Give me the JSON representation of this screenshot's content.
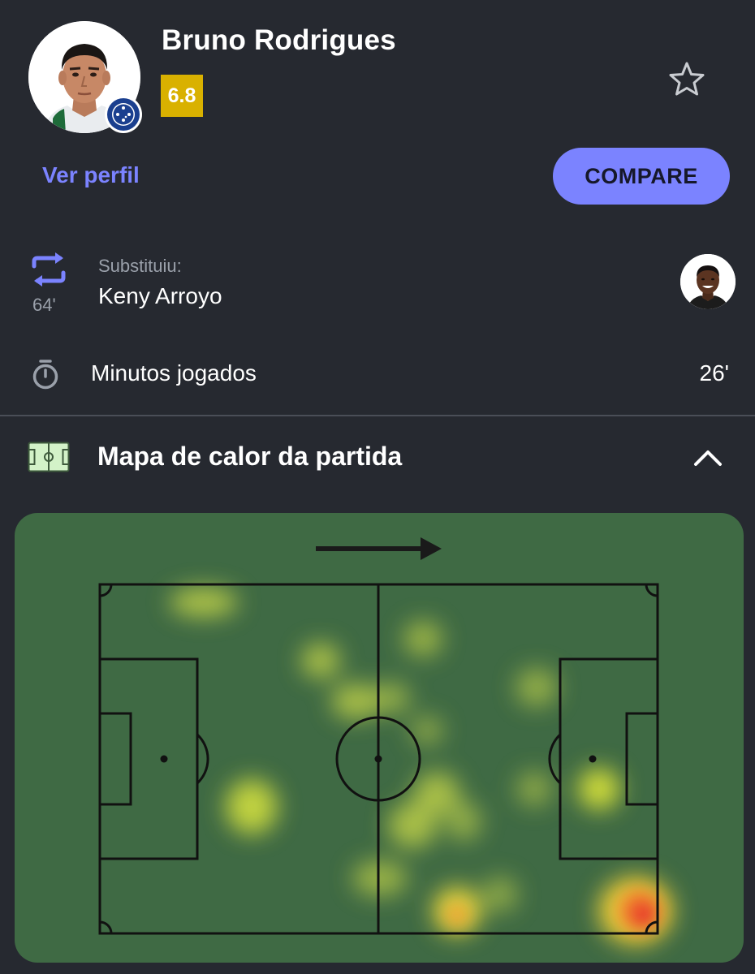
{
  "player": {
    "name": "Bruno Rodrigues",
    "rating": "6.8",
    "rating_color": "#d9b100",
    "club_badge_icon": "cruzeiro-badge-icon"
  },
  "actions": {
    "profile_link": "Ver perfil",
    "compare_button": "COMPARE",
    "accent_color": "#7b83ff"
  },
  "substitution": {
    "label": "Substituiu:",
    "player_name": "Keny Arroyo",
    "minute": "64'",
    "icon": "substitution-arrows-icon"
  },
  "minutes_played": {
    "label": "Minutos jogados",
    "value": "26'",
    "icon": "stopwatch-icon"
  },
  "heatmap_section": {
    "title": "Mapa de calor da partida",
    "icon": "pitch-icon",
    "collapse_icon": "chevron-up-icon",
    "attack_direction": "right",
    "pitch_color": "#3f6a44"
  }
}
